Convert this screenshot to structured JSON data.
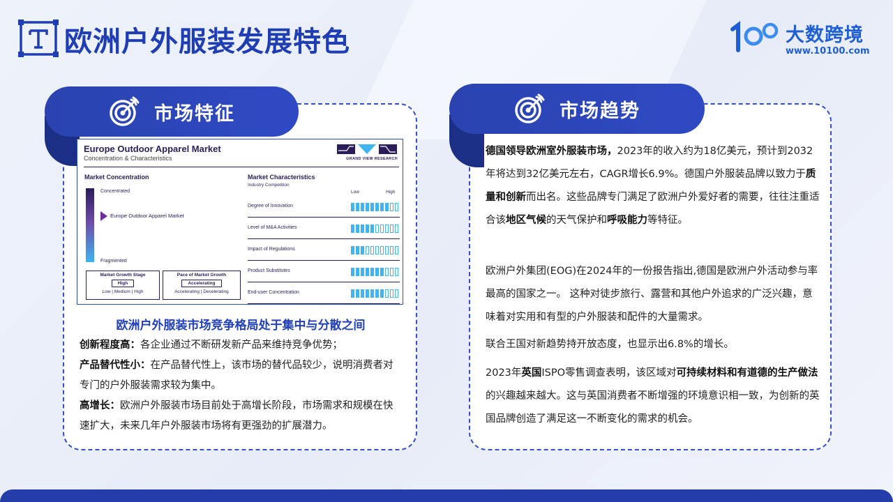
{
  "page": {
    "title": "欧洲户外服装发展特色"
  },
  "logo": {
    "name": "大数跨境",
    "url": "www.10100.com"
  },
  "left_card": {
    "tab_label": "市场特征",
    "caption": "欧洲户外服装市场竞争格局处于集中与分散之间",
    "points": [
      {
        "label": "创新程度高：",
        "text": "各企业通过不断研发新产品来维持竞争优势；"
      },
      {
        "label": "产品替代性小：",
        "text": "在产品替代性上，该市场的替代品较少，说明消费者对专门的户外服装需求较为集中。"
      },
      {
        "label": "高增长：",
        "text": "欧洲户外服装市场目前处于高增长阶段，市场需求和规模在快速扩大，未来几年户外服装市场将有更强劲的扩展潜力。"
      }
    ]
  },
  "chart_image": {
    "title": "Europe Outdoor Apparel Market",
    "subtitle": "Concentration & Characteristics",
    "brand": "GRAND VIEW RESEARCH",
    "concentration": {
      "heading": "Market Concentration",
      "top_label": "Concentrated",
      "bottom_label": "Fragmented",
      "marker_label": "Europe Outdoor Apparel Market",
      "marker_level": 0.62
    },
    "growth_stage": {
      "heading": "Market Growth Stage",
      "value": "High",
      "options": "Low | Medium | High"
    },
    "growth_pace": {
      "heading": "Pace of Market Growth",
      "value": "Accelerating",
      "options": "Accelerating | Decelerating"
    },
    "characteristics": {
      "heading": "Market Characteristics",
      "subheading": "Industry Competition",
      "low_label": "Low",
      "high_label": "High",
      "rows": [
        {
          "label": "Degree of Innovation",
          "filled": 8
        },
        {
          "label": "Level of M&A Activities",
          "filled": 5
        },
        {
          "label": "Impact of Regulations",
          "filled": 3
        },
        {
          "label": "Product Substitutes",
          "filled": 7
        },
        {
          "label": "End-user Concentration",
          "filled": 7
        }
      ],
      "total_segments": 10
    }
  },
  "right_card": {
    "tab_label": "市场趋势",
    "paragraphs": [
      [
        {
          "b": "德国领导欧洲室外服装市场，"
        },
        {
          "t": "2023年的收入约为18亿美元，预计到2032年将达到32亿美元左右，CAGR增长6.9%。德国户外服装品牌以致力于"
        },
        {
          "b": "质量和创新"
        },
        {
          "t": "而出名。这些品牌专门满足了欧洲户外爱好者的需要，往往注重适合该"
        },
        {
          "b": "地区气候"
        },
        {
          "t": "的天气保护和"
        },
        {
          "b": "呼吸能力"
        },
        {
          "t": "等特征。"
        }
      ],
      [
        {
          "t": "欧洲户外集团(EOG)在2024年的一份报告指出,德国是欧洲户外活动参与率最高的国家之一。 这种对徒步旅行、露营和其他户外追求的广泛兴趣，意味着对实用和有型的户外服装和配件的大量需求。"
        }
      ],
      [
        {
          "t": "联合王国对新趋势持开放态度，也显示出6.8%的增长。"
        }
      ],
      [
        {
          "t": "2023年"
        },
        {
          "b": "英国"
        },
        {
          "t": "ISPO零售调查表明，该区域对"
        },
        {
          "b": "可持续材料和有道德的生产做法"
        },
        {
          "t": "的兴趣越来越大。这与英国消费者不断增强的环境意识相一致，为创新的英国品牌创造了满足这一不断变化的需求的机会。"
        }
      ]
    ]
  }
}
